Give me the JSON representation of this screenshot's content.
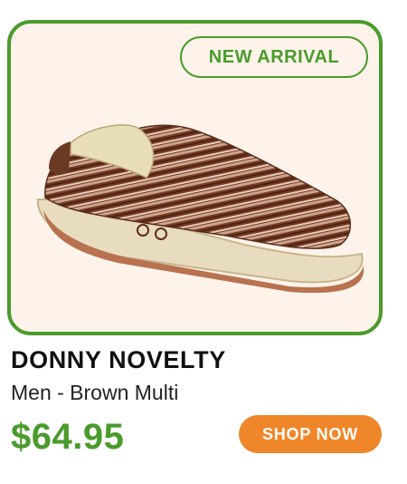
{
  "badge": {
    "label": "NEW ARRIVAL"
  },
  "product": {
    "name": "DONNY NOVELTY",
    "variant": "Men - Brown Multi",
    "price": "$64.95",
    "image": "brown-striped-slip-on-shoe"
  },
  "cta": {
    "label": "SHOP NOW"
  },
  "colors": {
    "accent_green": "#4a9b2c",
    "card_bg": "#fdf3ea",
    "button_orange": "#f0862a"
  }
}
